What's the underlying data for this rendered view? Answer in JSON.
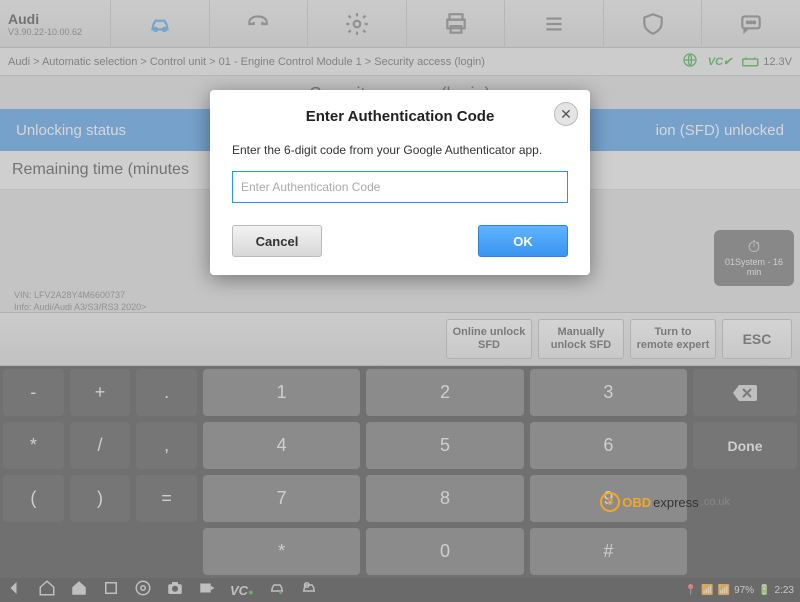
{
  "header": {
    "title": "Audi",
    "version": "V3.90.22-10.00.62"
  },
  "breadcrumb": "Audi > Automatic selection > Control unit > 01 - Engine Control Module 1 > Security access (login)",
  "status_right": {
    "vc": "VC",
    "voltage": "12.3V"
  },
  "page_title": "Security access (login)",
  "status_row": {
    "left": "Unlocking status",
    "right": "ion (SFD) unlocked"
  },
  "remaining_label": "Remaining time (minutes",
  "vin": {
    "line1": "VIN: LFV2A28Y4M6600737",
    "line2": "Info: Audi/Audi A3/S3/RS3 2020>"
  },
  "timer": {
    "line": "01System - 16 min"
  },
  "actions": {
    "online": "Online unlock SFD",
    "manual": "Manually unlock SFD",
    "expert": "Turn to remote expert",
    "esc": "ESC"
  },
  "keypad": {
    "left": [
      "-",
      "+",
      ".",
      "*",
      "/",
      ",",
      "(",
      ")",
      "=",
      "",
      "",
      ""
    ],
    "mid": [
      "1",
      "2",
      "3",
      "4",
      "5",
      "6",
      "7",
      "8",
      "9",
      "*",
      "0",
      "#"
    ],
    "right_done": "Done"
  },
  "sys": {
    "batt": "97%",
    "time": "2:23"
  },
  "modal": {
    "title": "Enter Authentication Code",
    "message": "Enter the 6-digit code from your Google Authenticator app.",
    "placeholder": "Enter Authentication Code",
    "cancel": "Cancel",
    "ok": "OK"
  },
  "watermark": {
    "a": "OBD",
    "b": "express",
    "c": ".co.uk"
  }
}
